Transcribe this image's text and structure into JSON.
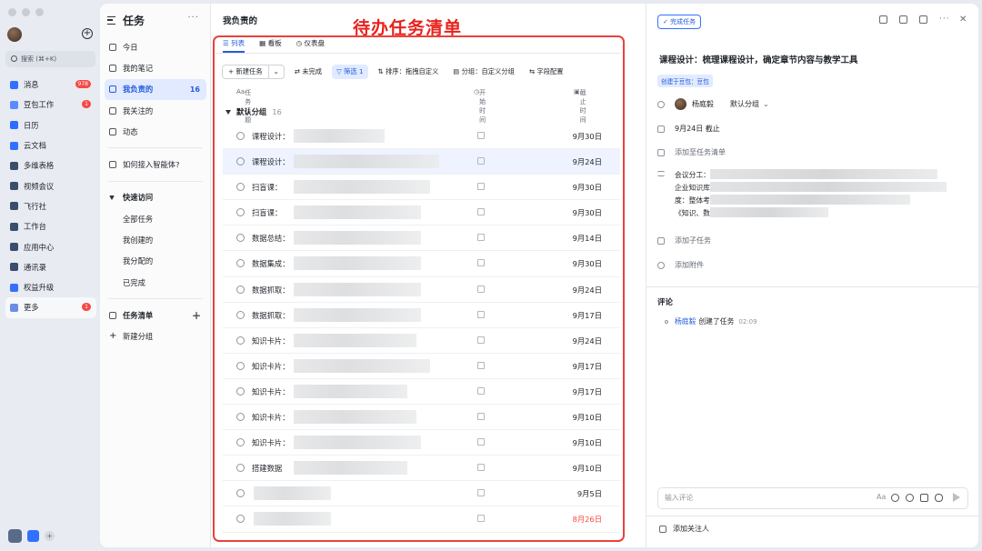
{
  "rail": {
    "search_placeholder": "搜索 (⌘+K)",
    "items": [
      {
        "label": "消息",
        "badge": "978",
        "color": "#3370ff"
      },
      {
        "label": "豆包工作",
        "badge": "1",
        "color": "#5b8cff"
      },
      {
        "label": "日历",
        "badge": "",
        "color": "#2f6bff"
      },
      {
        "label": "云文档",
        "badge": "",
        "color": "#3370ff"
      },
      {
        "label": "多维表格",
        "badge": "",
        "color": "#3a4d6b"
      },
      {
        "label": "视频会议",
        "badge": "",
        "color": "#3a4d6b"
      },
      {
        "label": "飞行社",
        "badge": "",
        "color": "#3a4d6b"
      },
      {
        "label": "工作台",
        "badge": "",
        "color": "#3a4d6b"
      },
      {
        "label": "应用中心",
        "badge": "",
        "color": "#3a4d6b"
      },
      {
        "label": "通讯录",
        "badge": "",
        "color": "#3a4d6b"
      },
      {
        "label": "权益升级",
        "badge": "",
        "color": "#3370ff"
      },
      {
        "label": "更多",
        "badge": "1",
        "color": "#6b8de6"
      }
    ]
  },
  "tasknav": {
    "title": "任务",
    "items": [
      {
        "label": "今日",
        "count": ""
      },
      {
        "label": "我的笔记",
        "count": ""
      },
      {
        "label": "我负责的",
        "count": "16"
      },
      {
        "label": "我关注的",
        "count": ""
      },
      {
        "label": "动态",
        "count": ""
      }
    ],
    "agent_link": "如何接入智能体?",
    "quick_access": {
      "title": "快速访问",
      "items": [
        "全部任务",
        "我创建的",
        "我分配的",
        "已完成"
      ]
    },
    "task_lists": "任务清单",
    "new_group": "新建分组"
  },
  "main": {
    "title": "我负责的",
    "annotation": "待办任务清单",
    "tabs": [
      "列表",
      "看板",
      "仪表盘"
    ],
    "toolbar": {
      "new_task": "+ 新建任务",
      "unfinished": "未完成",
      "filter": "筛选 1",
      "sort": "排序：拖拽自定义",
      "group": "分组：自定义分组",
      "fields": "字段配置"
    },
    "columns": {
      "title": "任务标题",
      "start": "开始时间",
      "due": "截止时间"
    },
    "group": {
      "name": "默认分组",
      "count": "16"
    },
    "tasks": [
      {
        "name": "课程设计：",
        "due": "9月30日"
      },
      {
        "name": "课程设计：",
        "due": "9月24日"
      },
      {
        "name": "扫盲课：",
        "due": "9月30日"
      },
      {
        "name": "扫盲课：",
        "due": "9月30日"
      },
      {
        "name": "数据总结：",
        "due": "9月14日"
      },
      {
        "name": "数据集成：",
        "due": "9月30日"
      },
      {
        "name": "数据抓取：",
        "due": "9月24日"
      },
      {
        "name": "数据抓取：",
        "due": "9月17日"
      },
      {
        "name": "知识卡片：",
        "due": "9月24日"
      },
      {
        "name": "知识卡片：",
        "due": "9月17日"
      },
      {
        "name": "知识卡片：",
        "due": "9月17日"
      },
      {
        "name": "知识卡片：",
        "due": "9月10日"
      },
      {
        "name": "知识卡片：",
        "due": "9月10日"
      },
      {
        "name": "搭建数据",
        "due": "9月10日"
      },
      {
        "name": "",
        "due": "9月5日"
      },
      {
        "name": "",
        "due": "8月26日",
        "overdue": true
      }
    ]
  },
  "detail": {
    "complete_button": "完成任务",
    "title": "课程设计：梳理课程设计，确定章节内容与教学工具",
    "created_from": "创建于豆包：豆包",
    "assignee": "杨庭毅",
    "group": "默认分组",
    "due": "9月24日 截止",
    "add_to_list": "添加至任务清单",
    "desc_lines": [
      "会议分工：",
      "企业知识库",
      "度：整体考",
      "《知识、数"
    ],
    "add_subtask": "添加子任务",
    "add_attachment": "添加附件",
    "comments_title": "评论",
    "comment": {
      "who": "杨庭毅",
      "text": "创建了任务",
      "time": "02:09"
    },
    "comment_placeholder": "输入评论",
    "add_follower": "添加关注人"
  }
}
